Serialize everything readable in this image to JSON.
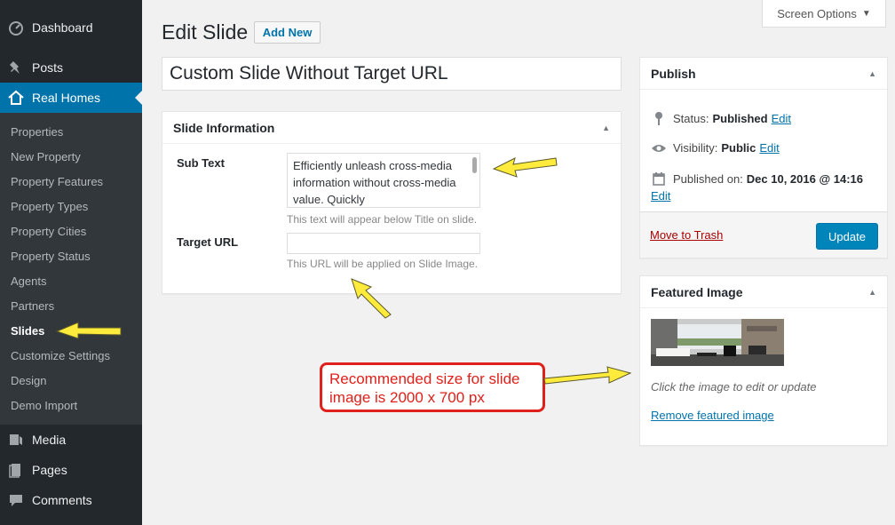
{
  "sidebar": {
    "top_items": [
      {
        "label": "Dashboard",
        "icon": "dashboard-icon"
      },
      {
        "label": "Posts",
        "icon": "pin-icon"
      },
      {
        "label": "Real Homes",
        "icon": "home-icon",
        "current": true
      }
    ],
    "sub_items": [
      "Properties",
      "New Property",
      "Property Features",
      "Property Types",
      "Property Cities",
      "Property Status",
      "Agents",
      "Partners",
      "Slides",
      "Customize Settings",
      "Design",
      "Demo Import"
    ],
    "bottom_items": [
      {
        "label": "Media",
        "icon": "media-icon"
      },
      {
        "label": "Pages",
        "icon": "pages-icon"
      },
      {
        "label": "Comments",
        "icon": "comments-icon"
      }
    ]
  },
  "header": {
    "title": "Edit Slide",
    "add_new": "Add New",
    "screen_options": "Screen Options"
  },
  "title_value": "Custom Slide Without Target URL",
  "slide_info": {
    "heading": "Slide Information",
    "sub_text_label": "Sub Text",
    "sub_text_value": "Efficiently unleash cross-media information without cross-media value. Quickly",
    "sub_text_hint": "This text will appear below Title on slide.",
    "target_url_label": "Target URL",
    "target_url_value": "",
    "target_url_hint": "This URL will be applied on Slide Image."
  },
  "publish": {
    "heading": "Publish",
    "status_label": "Status:",
    "status_value": "Published",
    "visibility_label": "Visibility:",
    "visibility_value": "Public",
    "published_label": "Published on:",
    "published_value": "Dec 10, 2016 @ 14:16",
    "edit": "Edit",
    "trash": "Move to Trash",
    "update": "Update"
  },
  "featured": {
    "heading": "Featured Image",
    "caption": "Click the image to edit or update",
    "remove": "Remove featured image"
  },
  "callout": "Recommended size for slide image is 2000 x 700 px",
  "colors": {
    "sidebar": "#23282d",
    "submenu": "#32373c",
    "accent": "#0073aa",
    "button": "#0085ba",
    "annotation_red": "#e0201b",
    "arrow_yellow": "#ffeb3b"
  }
}
